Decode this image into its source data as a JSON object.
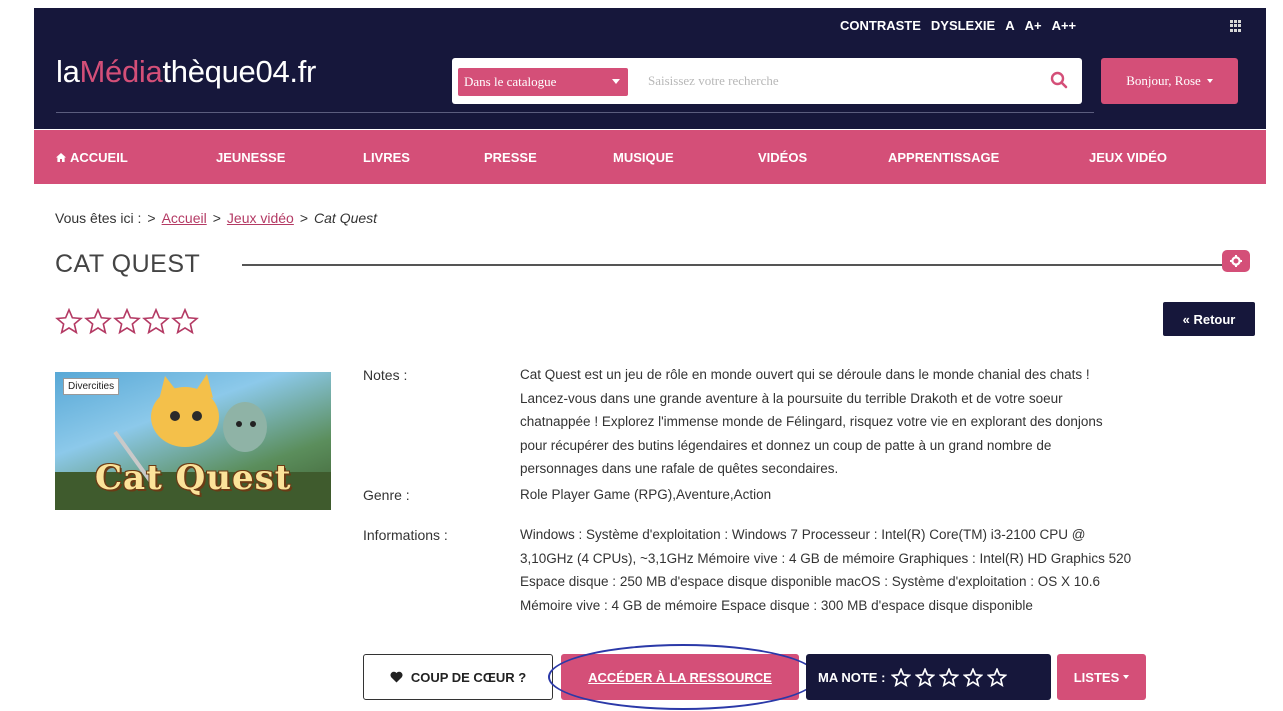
{
  "accessibility": {
    "contrast": "CONTRASTE",
    "dyslexia": "DYSLEXIE",
    "font_a": "A",
    "font_a_plus": "A+",
    "font_a_plus_plus": "A++"
  },
  "header": {
    "logo_prefix": "la",
    "logo_accent": "Médi",
    "logo_middle": "a",
    "logo_suffix": "thèque04.fr",
    "search_scope": "Dans le catalogue",
    "search_placeholder": "Saisissez votre recherche",
    "user_greeting": "Bonjour, Rose"
  },
  "nav": {
    "items": [
      "ACCUEIL",
      "JEUNESSE",
      "LIVRES",
      "PRESSE",
      "MUSIQUE",
      "VIDÉOS",
      "APPRENTISSAGE",
      "JEUX VIDÉO"
    ]
  },
  "breadcrumb": {
    "prefix": "Vous êtes ici :",
    "separator": ">",
    "home": "Accueil",
    "section": "Jeux vidéo",
    "current": "Cat Quest"
  },
  "item": {
    "title": "CAT QUEST",
    "back_label": "« Retour",
    "rating_stars": 0,
    "cover_badge": "Divercities",
    "cover_title": "Cat Quest",
    "notes_label": "Notes :",
    "notes_lines": [
      "Cat Quest est un jeu de rôle en monde ouvert qui se déroule dans le monde chanial des chats !",
      "Lancez-vous dans une grande aventure à la poursuite du terrible Drakoth et de votre soeur",
      "chatnappée ! Explorez l'immense monde de Félingard, risquez votre vie en explorant des donjons",
      "pour récupérer des butins légendaires et donnez un coup de patte à un grand nombre de",
      "personnages dans une rafale de quêtes secondaires."
    ],
    "genre_label": "Genre :",
    "genre_value": "Role Player Game (RPG),Aventure,Action",
    "info_label": "Informations :",
    "info_lines": [
      "Windows : Système d'exploitation : Windows 7 Processeur : Intel(R) Core(TM) i3-2100 CPU @",
      "3,10GHz (4 CPUs), ~3,1GHz Mémoire vive : 4 GB de mémoire Graphiques : Intel(R) HD Graphics 520",
      "Espace disque : 250 MB d'espace disque disponible macOS : Système d'exploitation : OS X 10.6",
      "Mémoire vive : 4 GB de mémoire Espace disque : 300 MB d'espace disque disponible"
    ]
  },
  "actions": {
    "favorite": "COUP DE CŒUR ?",
    "access": "ACCÉDER À LA RESSOURCE",
    "my_rating": "MA NOTE :",
    "my_rating_stars": 0,
    "lists": "LISTES"
  },
  "colors": {
    "navy": "#16173b",
    "pink": "#d44f78",
    "highlight": "#2b39a8"
  }
}
